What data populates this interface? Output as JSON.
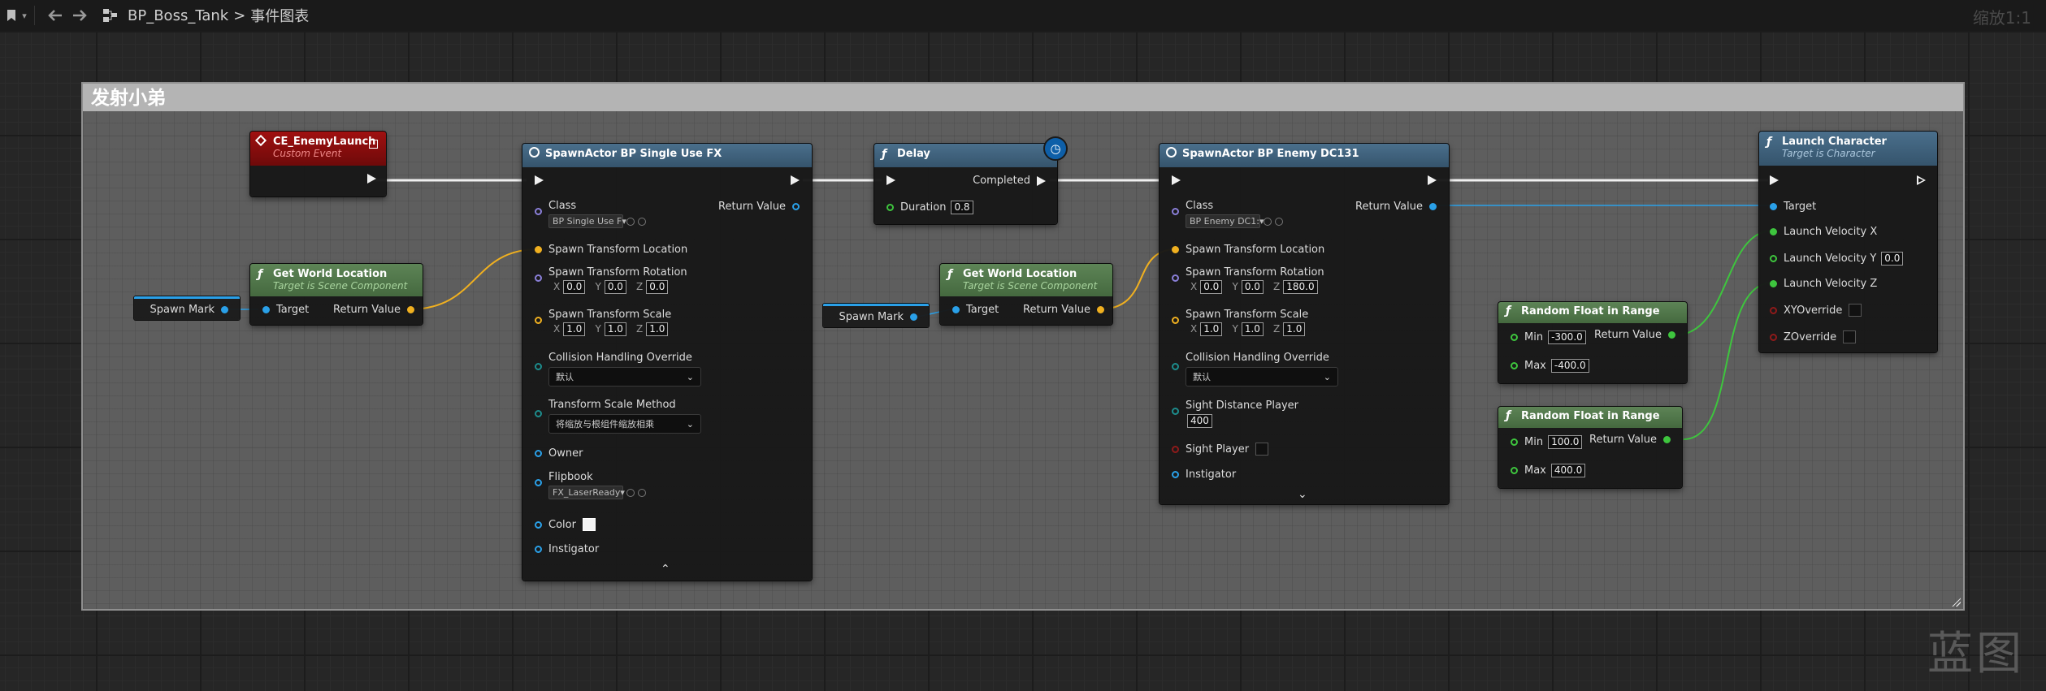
{
  "topbar": {
    "breadcrumb_root": "BP_Boss_Tank",
    "breadcrumb_sep": ">",
    "breadcrumb_leaf": "事件图表",
    "zoom": "缩放1:1"
  },
  "watermark": "蓝图",
  "comment_title": "发射小弟",
  "nodes": {
    "ce_enemy_launch": {
      "title": "CE_EnemyLaunch",
      "subtitle": "Custom Event"
    },
    "get_world_location_1": {
      "title": "Get World Location",
      "subtitle": "Target is Scene Component",
      "target": "Target",
      "ret": "Return Value"
    },
    "spawn_mark_1": {
      "label": "Spawn Mark"
    },
    "spawn_fx": {
      "title": "SpawnActor BP Single Use FX",
      "class_label": "Class",
      "class_value": "BP Single Use F",
      "return_value": "Return Value",
      "stl": "Spawn Transform Location",
      "str": "Spawn Transform Rotation",
      "rot": [
        "0.0",
        "0.0",
        "0.0"
      ],
      "sts": "Spawn Transform Scale",
      "scale": [
        "1.0",
        "1.0",
        "1.0"
      ],
      "cho": "Collision Handling Override",
      "cho_value": "默认",
      "tsm": "Transform Scale Method",
      "tsm_value": "将缩放与根组件缩放相乘",
      "owner": "Owner",
      "flipbook": "Flipbook",
      "flipbook_value": "FX_LaserReady",
      "color": "Color",
      "instigator": "Instigator"
    },
    "delay": {
      "title": "Delay",
      "completed": "Completed",
      "duration_label": "Duration",
      "duration": "0.8"
    },
    "get_world_location_2": {
      "title": "Get World Location",
      "subtitle": "Target is Scene Component",
      "target": "Target",
      "ret": "Return Value"
    },
    "spawn_mark_2": {
      "label": "Spawn Mark"
    },
    "spawn_enemy": {
      "title": "SpawnActor BP Enemy DC131",
      "class_label": "Class",
      "class_value": "BP Enemy DC1:",
      "return_value": "Return Value",
      "stl": "Spawn Transform Location",
      "str": "Spawn Transform Rotation",
      "rot": [
        "0.0",
        "0.0",
        "180.0"
      ],
      "sts": "Spawn Transform Scale",
      "scale": [
        "1.0",
        "1.0",
        "1.0"
      ],
      "cho": "Collision Handling Override",
      "cho_value": "默认",
      "sdp": "Sight Distance Player",
      "sdp_value": "400",
      "sight_player": "Sight Player",
      "instigator": "Instigator"
    },
    "random_1": {
      "title": "Random Float in Range",
      "min_label": "Min",
      "min": "-300.0",
      "max_label": "Max",
      "max": "-400.0",
      "ret": "Return Value"
    },
    "random_2": {
      "title": "Random Float in Range",
      "min_label": "Min",
      "min": "100.0",
      "max_label": "Max",
      "max": "400.0",
      "ret": "Return Value"
    },
    "launch": {
      "title": "Launch Character",
      "subtitle": "Target is Character",
      "target": "Target",
      "lvx": "Launch Velocity X",
      "lvy": "Launch Velocity Y",
      "lvy_value": "0.0",
      "lvz": "Launch Velocity Z",
      "xyo": "XYOverride",
      "zo": "ZOverride"
    }
  },
  "axis_labels": {
    "x": "X",
    "y": "Y",
    "z": "Z"
  },
  "colors": {
    "exec": "#f0f0f0",
    "object": "#2aa0e8",
    "vector": "#f0b020",
    "float": "#3ec53e",
    "comment_bg": "#6e6e6e"
  }
}
